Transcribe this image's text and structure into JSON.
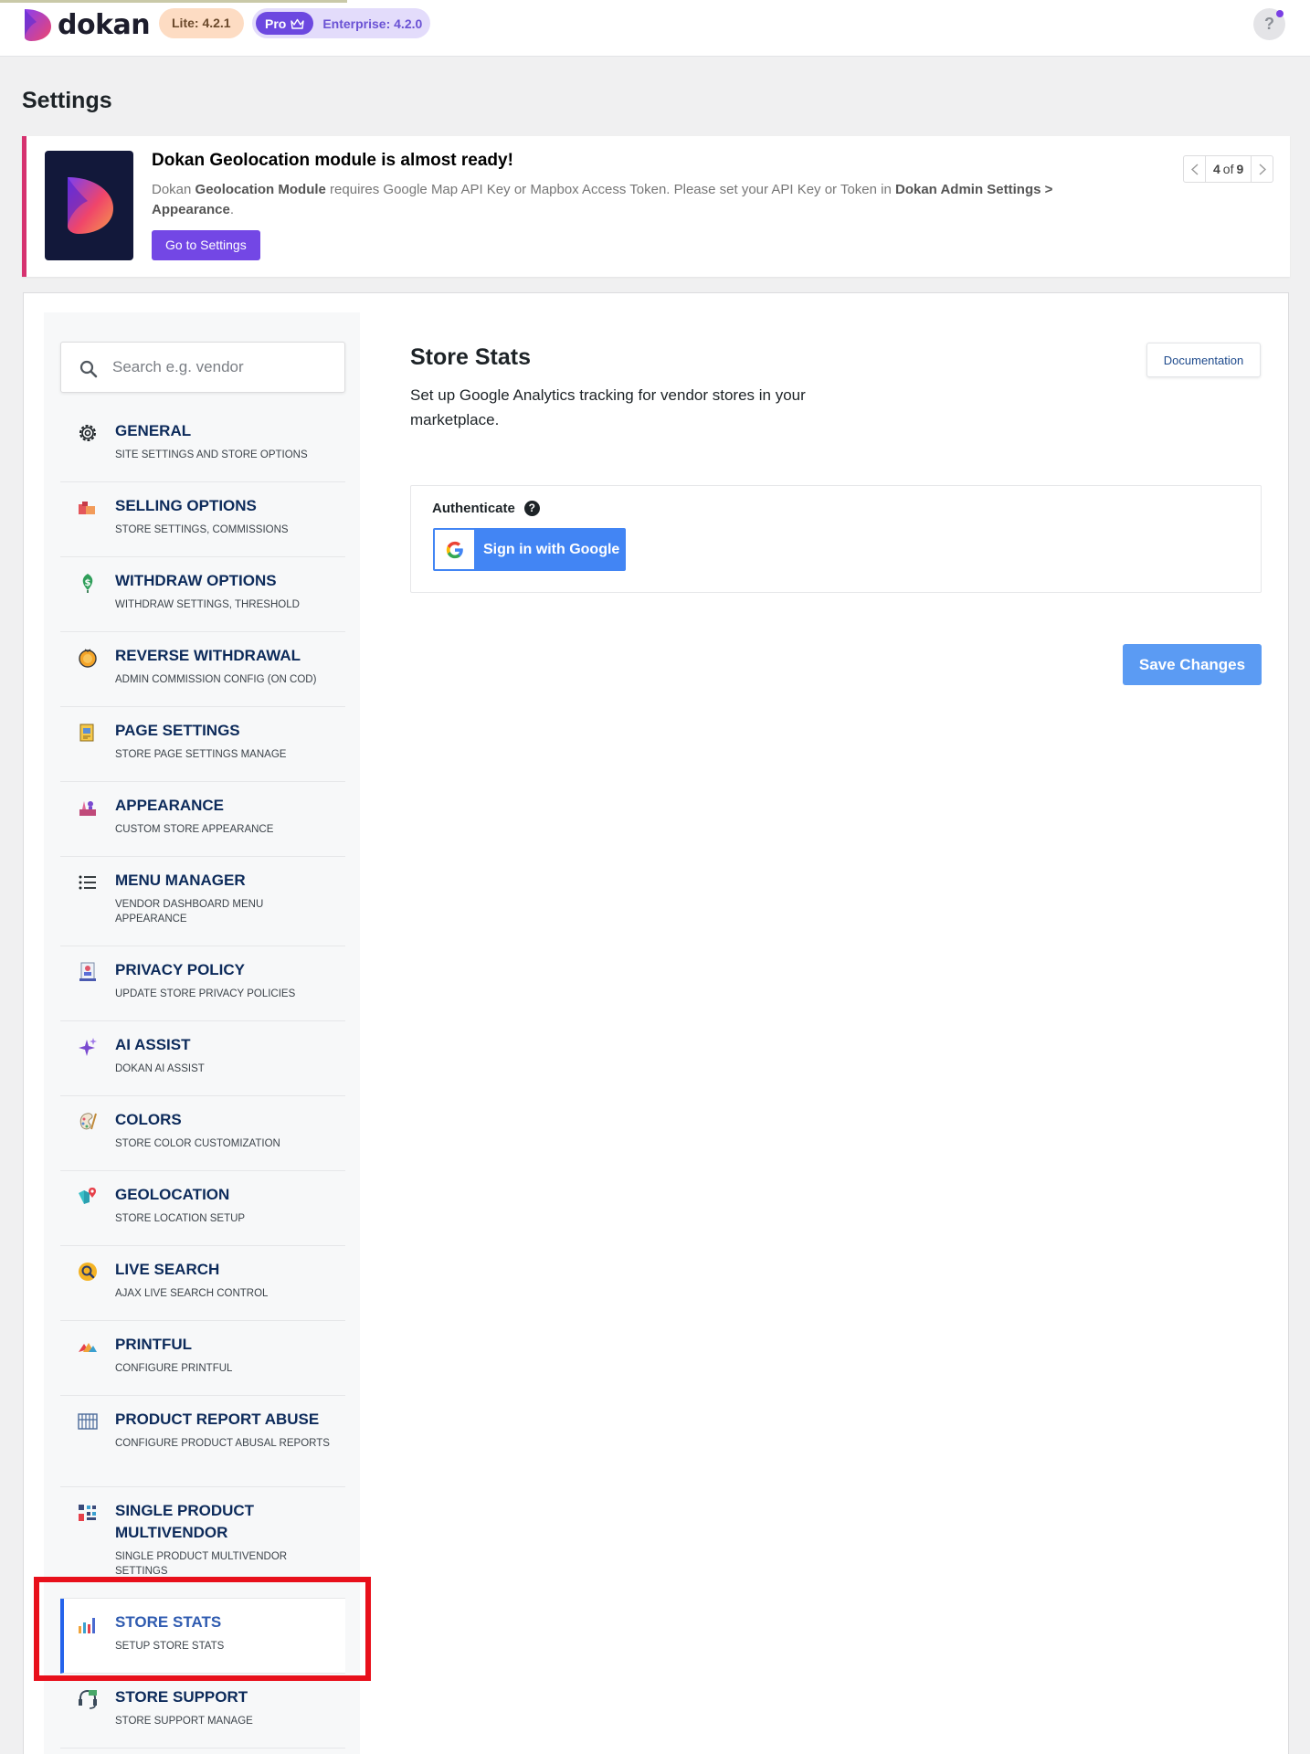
{
  "header": {
    "logo_text": "dokan",
    "lite_badge": "Lite: 4.2.1",
    "pro_label": "Pro",
    "enterprise_badge": "Enterprise: 4.2.0",
    "help_label": "?"
  },
  "page_title": "Settings",
  "notice": {
    "title": "Dokan Geolocation module is almost ready!",
    "body_prefix": "Dokan ",
    "body_bold1": "Geolocation Module",
    "body_mid": " requires Google Map API Key or Mapbox Access Token. Please set your API Key or Token in ",
    "body_bold2": "Dokan Admin Settings > Appearance",
    "body_suffix": ".",
    "button": "Go to Settings",
    "pager_current": "4",
    "pager_of": "of",
    "pager_total": "9"
  },
  "search": {
    "placeholder": "Search e.g. vendor"
  },
  "sidebar": {
    "items": [
      {
        "label": "General",
        "sub": "Site settings and store options",
        "icon": "gear-icon"
      },
      {
        "label": "Selling Options",
        "sub": "Store settings, commissions",
        "icon": "cart-icon"
      },
      {
        "label": "Withdraw Options",
        "sub": "Withdraw settings, threshold",
        "icon": "money-icon"
      },
      {
        "label": "Reverse Withdrawal",
        "sub": "Admin commission config (on COD)",
        "icon": "coin-icon"
      },
      {
        "label": "Page Settings",
        "sub": "Store page settings manage",
        "icon": "page-icon"
      },
      {
        "label": "Appearance",
        "sub": "Custom store appearance",
        "icon": "appearance-icon"
      },
      {
        "label": "Menu Manager",
        "sub": "Vendor dashboard menu appearance",
        "icon": "list-icon"
      },
      {
        "label": "Privacy Policy",
        "sub": "Update store privacy policies",
        "icon": "privacy-icon"
      },
      {
        "label": "AI Assist",
        "sub": "Dokan AI assist",
        "icon": "sparkle-icon"
      },
      {
        "label": "Colors",
        "sub": "Store color customization",
        "icon": "palette-icon"
      },
      {
        "label": "Geolocation",
        "sub": "Store location setup",
        "icon": "map-pin-icon"
      },
      {
        "label": "Live Search",
        "sub": "Ajax live search control",
        "icon": "search-magnifier-icon"
      },
      {
        "label": "Printful",
        "sub": "Configure printful",
        "icon": "printful-icon"
      },
      {
        "label": "Product Report Abuse",
        "sub": "Configure product abusal reports",
        "icon": "report-icon"
      },
      {
        "label": "Single Product Multivendor",
        "sub": "Single product multivendor settings",
        "icon": "multivendor-icon"
      },
      {
        "label": "Store Stats",
        "sub": "Setup store stats",
        "icon": "bar-chart-icon"
      },
      {
        "label": "Store Support",
        "sub": "Store support manage",
        "icon": "headset-icon"
      }
    ]
  },
  "main": {
    "title": "Store Stats",
    "description": "Set up Google Analytics tracking for vendor stores in your marketplace.",
    "doc_button": "Documentation",
    "auth_label": "Authenticate",
    "auth_help": "?",
    "google_button": "Sign in with Google",
    "save_button": "Save Changes"
  },
  "colors": {
    "accent": "#7347e5",
    "active_border": "#2563eb",
    "highlight": "#e8101b",
    "google_blue": "#4285f4",
    "save_blue": "#5b9bf3"
  }
}
